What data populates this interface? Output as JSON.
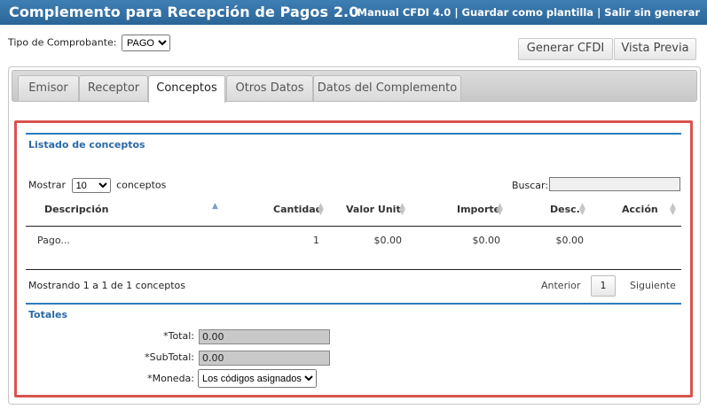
{
  "header": {
    "title": "Complemento para Recepción de Pagos  2.0",
    "link_manual": "Manual CFDI 4.0",
    "link_plantilla": "Guardar como plantilla",
    "link_salir": "Salir sin generar",
    "separator": " | "
  },
  "tipo": {
    "label": "Tipo de Comprobante:",
    "value": "PAGO"
  },
  "actions": {
    "generar": "Generar CFDI",
    "vista_previa": "Vista Previa"
  },
  "tabs": [
    {
      "label": "Emisor"
    },
    {
      "label": "Receptor"
    },
    {
      "label": "Conceptos"
    },
    {
      "label": "Otros Datos"
    },
    {
      "label": "Datos del Complemento"
    }
  ],
  "conceptos": {
    "section_title": "Listado de conceptos",
    "mostrar_label": "Mostrar",
    "mostrar_value": "10",
    "mostrar_suffix": "conceptos",
    "buscar_label": "Buscar:",
    "columns": {
      "descripcion": "Descripción",
      "cantidad": "Cantidad",
      "valor_unit": "Valor Unit.",
      "importe": "Importe",
      "desc": "Desc.",
      "accion": "Acción"
    },
    "rows": [
      {
        "descripcion": "Pago...",
        "cantidad": "1",
        "valor_unit": "$0.00",
        "importe": "$0.00",
        "desc": "$0.00",
        "accion": ""
      }
    ],
    "info": "Mostrando 1 a 1 de 1 conceptos",
    "anterior": "Anterior",
    "page": "1",
    "siguiente": "Siguiente"
  },
  "totales": {
    "section_title": "Totales",
    "total_label": "*Total:",
    "total_value": "0.00",
    "subtotal_label": "*SubTotal:",
    "subtotal_value": "0.00",
    "moneda_label": "*Moneda:",
    "moneda_value": "Los códigos asignados"
  },
  "colors": {
    "header_bg": "#2b6597",
    "accent": "#2c7cbf",
    "highlight_border": "#d9534f"
  }
}
